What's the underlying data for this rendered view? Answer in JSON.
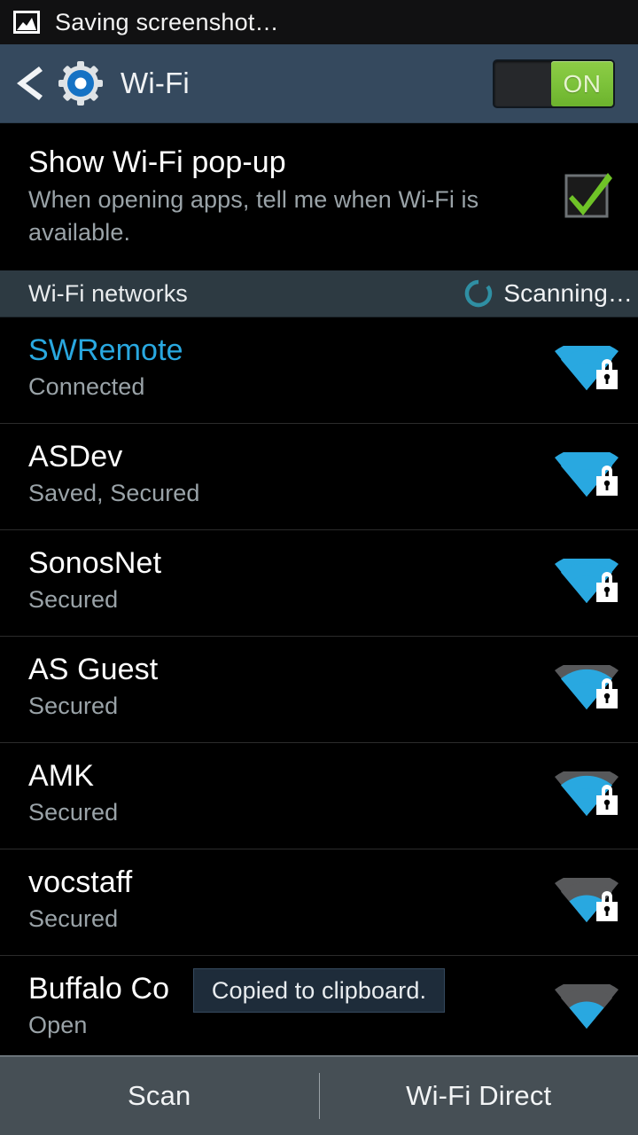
{
  "status_bar": {
    "icon": "screenshot-image-icon",
    "text": "Saving screenshot…"
  },
  "action_bar": {
    "back_icon": "back-chevron-icon",
    "app_icon": "settings-gear-icon",
    "title": "Wi-Fi",
    "switch": {
      "label": "ON",
      "state": "on",
      "track_color": "#26282b",
      "thumb_color": "#7cc23a"
    }
  },
  "popup_setting": {
    "title": "Show Wi-Fi pop-up",
    "summary": "When opening apps, tell me when Wi-Fi is available.",
    "checkbox": {
      "name": "show-wifi-popup-checkbox",
      "checked": true,
      "check_color": "#6fc327"
    }
  },
  "networks_section": {
    "title": "Wi-Fi networks",
    "scan_status": "Scanning…",
    "spinner_color": "#2f8fa3",
    "header_bg": "#2d3a42"
  },
  "networks": [
    {
      "ssid": "SWRemote",
      "state": "Connected",
      "connected": true,
      "secured": true,
      "bars": 4
    },
    {
      "ssid": "ASDev",
      "state": "Saved, Secured",
      "connected": false,
      "secured": true,
      "bars": 4
    },
    {
      "ssid": "SonosNet",
      "state": "Secured",
      "connected": false,
      "secured": true,
      "bars": 4
    },
    {
      "ssid": "AS Guest",
      "state": "Secured",
      "connected": false,
      "secured": true,
      "bars": 3
    },
    {
      "ssid": "AMK",
      "state": "Secured",
      "connected": false,
      "secured": true,
      "bars": 3
    },
    {
      "ssid": "vocstaff",
      "state": "Secured",
      "connected": false,
      "secured": true,
      "bars": 2
    },
    {
      "ssid": "Buffalo Co",
      "state": "Open",
      "connected": false,
      "secured": false,
      "bars": 2
    }
  ],
  "toast": {
    "text": "Copied to clipboard."
  },
  "bottom_bar": {
    "scan_label": "Scan",
    "wifi_direct_label": "Wi-Fi Direct"
  },
  "colors": {
    "accent_blue": "#29a8e0",
    "action_bar": "#35495e",
    "screen_bg": "#000000",
    "bottom_bar": "#464f55",
    "toast_bg": "#1e2c3a",
    "signal_active": "#29a8e0",
    "signal_inactive": "#58595b"
  }
}
